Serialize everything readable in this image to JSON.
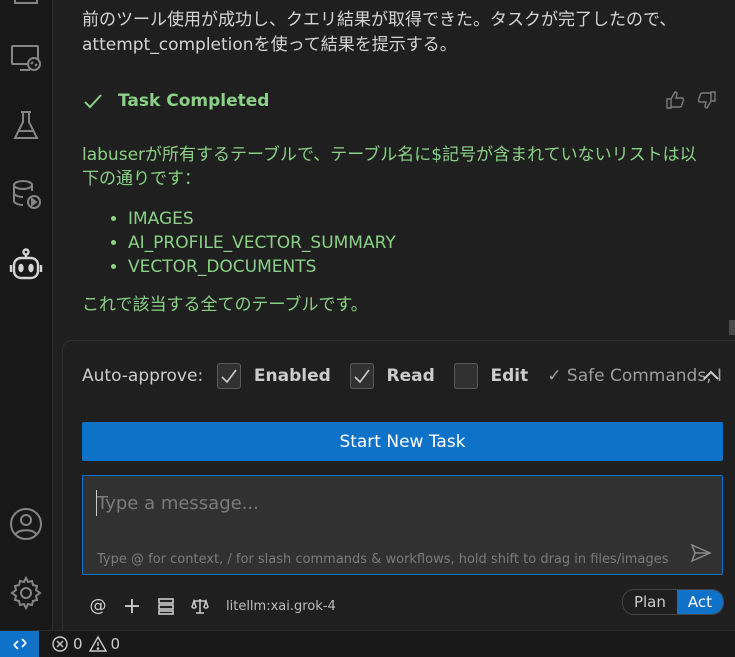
{
  "chat": {
    "message": "前のツール使用が成功し、クエリ結果が取得できた。タスクが完了したので、attempt_completionを使って結果を提示する。",
    "task_completed_title": "Task Completed",
    "result_intro": "labuserが所有するテーブルで、テーブル名に$記号が含まれていないリストは以下の通りです：",
    "result_items": [
      "IMAGES",
      "AI_PROFILE_VECTOR_SUMMARY",
      "VECTOR_DOCUMENTS"
    ],
    "result_outro": "これで該当する全てのテーブルです。"
  },
  "auto_approve": {
    "label": "Auto-approve:",
    "options": [
      {
        "label": "Enabled",
        "checked": true
      },
      {
        "label": "Read",
        "checked": true
      },
      {
        "label": "Edit",
        "checked": false
      }
    ],
    "safe_commands": "✓ Safe Commands, I"
  },
  "start_button_label": "Start New Task",
  "input": {
    "placeholder": "Type a message...",
    "hint": "Type @ for context, / for slash commands & workflows, hold shift to drag in files/images"
  },
  "toolbar": {
    "at_label": "@",
    "add_label": "+",
    "model": "litellm:xai.grok-4"
  },
  "mode": {
    "plan": "Plan",
    "act": "Act",
    "active": "Act"
  },
  "status": {
    "errors": "0",
    "warnings": "0"
  },
  "colors": {
    "accent": "#0e72c9",
    "success": "#89d185",
    "background": "#1f1f1f"
  }
}
